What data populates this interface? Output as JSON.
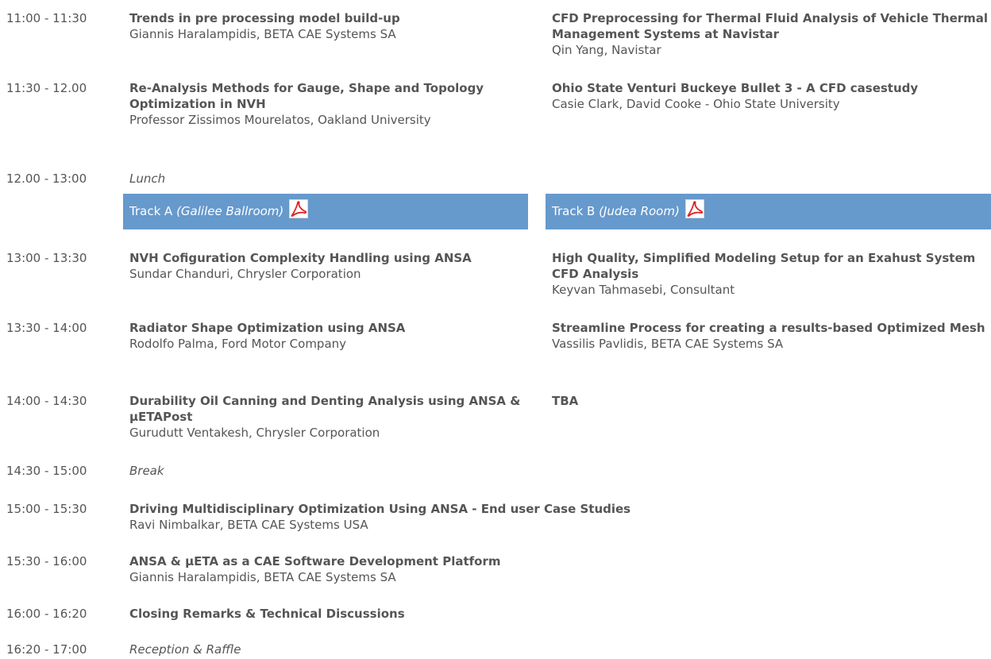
{
  "tracks": {
    "a": {
      "label": "Track A",
      "room": "(Galilee Ballroom)",
      "icon": "pdf-icon"
    },
    "b": {
      "label": "Track B",
      "room": "(Judea Room)",
      "icon": "pdf-icon"
    }
  },
  "rows": [
    {
      "time": "11:00 - 11:30",
      "a": {
        "title": "Trends in pre processing model build-up",
        "speaker": "Giannis Haralampidis, BETA CAE Systems SA"
      },
      "b": {
        "title": "CFD Preprocessing for Thermal Fluid Analysis of Vehicle Thermal Management Systems at Navistar",
        "speaker": "Qin Yang, Navistar"
      }
    },
    {
      "time": "11:30 - 12.00",
      "a": {
        "title": "Re-Analysis Methods for Gauge, Shape and Topology Optimization in NVH",
        "speaker": "Professor Zissimos Mourelatos, Oakland University"
      },
      "b": {
        "title": "Ohio State Venturi Buckeye Bullet 3 - A CFD casestudy",
        "speaker": "Casie Clark, David Cooke - Ohio State University"
      }
    },
    {
      "time": "12.00 - 13:00",
      "note": "Lunch"
    },
    {
      "time": "13:00 - 13:30",
      "a": {
        "title": "NVH Cofiguration Complexity Handling using ANSA",
        "speaker": "Sundar Chanduri, Chrysler Corporation"
      },
      "b": {
        "title": "High Quality, Simplified Modeling Setup for an Exahust System CFD Analysis",
        "speaker": "Keyvan Tahmasebi, Consultant"
      }
    },
    {
      "time": "13:30 - 14:00",
      "a": {
        "title": "Radiator Shape Optimization using ANSA",
        "speaker": "Rodolfo Palma, Ford Motor Company"
      },
      "b": {
        "title": "Streamline Process for creating a results-based Optimized Mesh",
        "speaker": "Vassilis Pavlidis, BETA CAE Systems SA"
      }
    },
    {
      "time": "14:00 - 14:30",
      "a": {
        "title": "Durability Oil Canning and Denting Analysis using ANSA & μETAPost",
        "speaker": "Gurudutt Ventakesh, Chrysler Corporation"
      },
      "b": {
        "title": "TBA"
      }
    },
    {
      "time": "14:30 - 15:00",
      "note": "Break"
    },
    {
      "time": "15:00 - 15:30",
      "full": {
        "title": "Driving Multidisciplinary Optimization Using ANSA - End user Case Studies",
        "speaker": "Ravi Nimbalkar, BETA CAE Systems USA"
      }
    },
    {
      "time": "15:30 - 16:00",
      "full": {
        "title": "ANSA & μETA as a CAE Software Development Platform",
        "speaker": "Giannis Haralampidis, BETA CAE Systems SA"
      }
    },
    {
      "time": "16:00 - 16:20",
      "full": {
        "title": "Closing Remarks & Technical Discussions"
      }
    },
    {
      "time": "16:20 - 17:00",
      "note": "Reception & Raffle"
    }
  ]
}
